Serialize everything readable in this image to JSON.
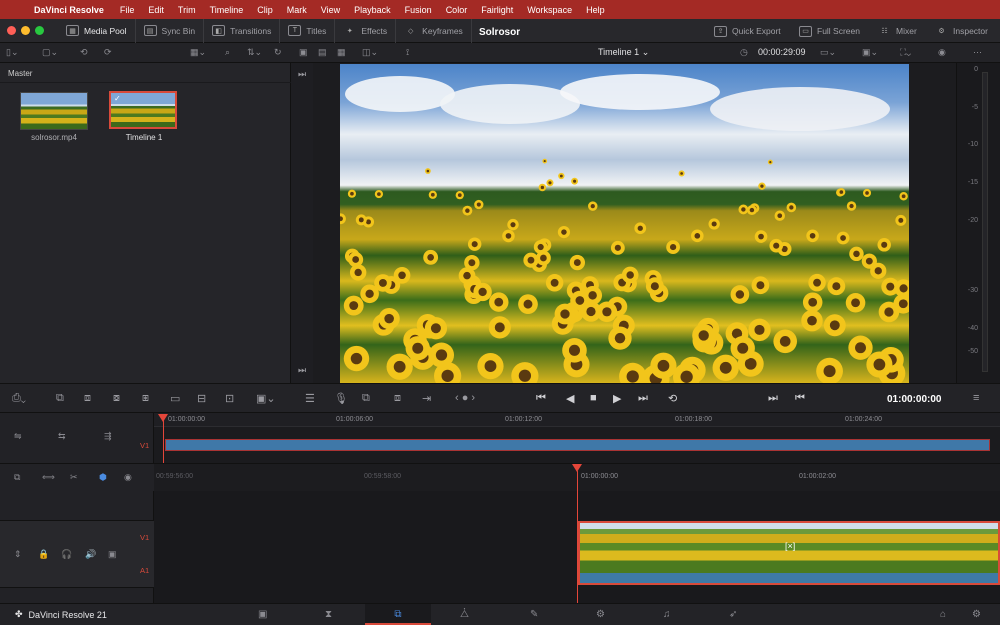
{
  "menubar": {
    "app_name": "DaVinci Resolve",
    "items": [
      "File",
      "Edit",
      "Trim",
      "Timeline",
      "Clip",
      "Mark",
      "View",
      "Playback",
      "Fusion",
      "Color",
      "Fairlight",
      "Workspace",
      "Help"
    ]
  },
  "toolbar": {
    "media_pool": "Media Pool",
    "sync_bin": "Sync Bin",
    "transitions": "Transitions",
    "titles": "Titles",
    "effects": "Effects",
    "keyframes": "Keyframes",
    "project_name": "Solrosor",
    "quick_export": "Quick Export",
    "full_screen": "Full Screen",
    "mixer": "Mixer",
    "inspector": "Inspector"
  },
  "viewer": {
    "timeline_name": "Timeline 1",
    "duration": "00:00:29:09"
  },
  "media_pool": {
    "bin": "Master",
    "clips": [
      {
        "name": "solrosor.mp4"
      },
      {
        "name": "Timeline 1"
      }
    ]
  },
  "meters": {
    "ticks": [
      "0",
      "-5",
      "-10",
      "-15",
      "-20",
      "-30",
      "-40",
      "-50"
    ]
  },
  "transport": {
    "timecode": "01:00:00:00"
  },
  "upper_timeline": {
    "ticks": [
      "01:00:00:00",
      "01:00:06:00",
      "01:00:12:00",
      "01:00:18:00",
      "01:00:24:00"
    ],
    "track_label": "V1"
  },
  "lower_timeline": {
    "ticks": [
      "00:59:56:00",
      "00:59:58:00",
      "01:00:00:00",
      "01:00:02:00"
    ],
    "video_track": "V1",
    "audio_track": "A1"
  },
  "footer": {
    "app_version": "DaVinci Resolve 21"
  },
  "colors": {
    "menubar": "#a42a25",
    "playhead": "#e4463a",
    "clip_blue": "#3f78a8",
    "selection": "#d84a3a"
  }
}
